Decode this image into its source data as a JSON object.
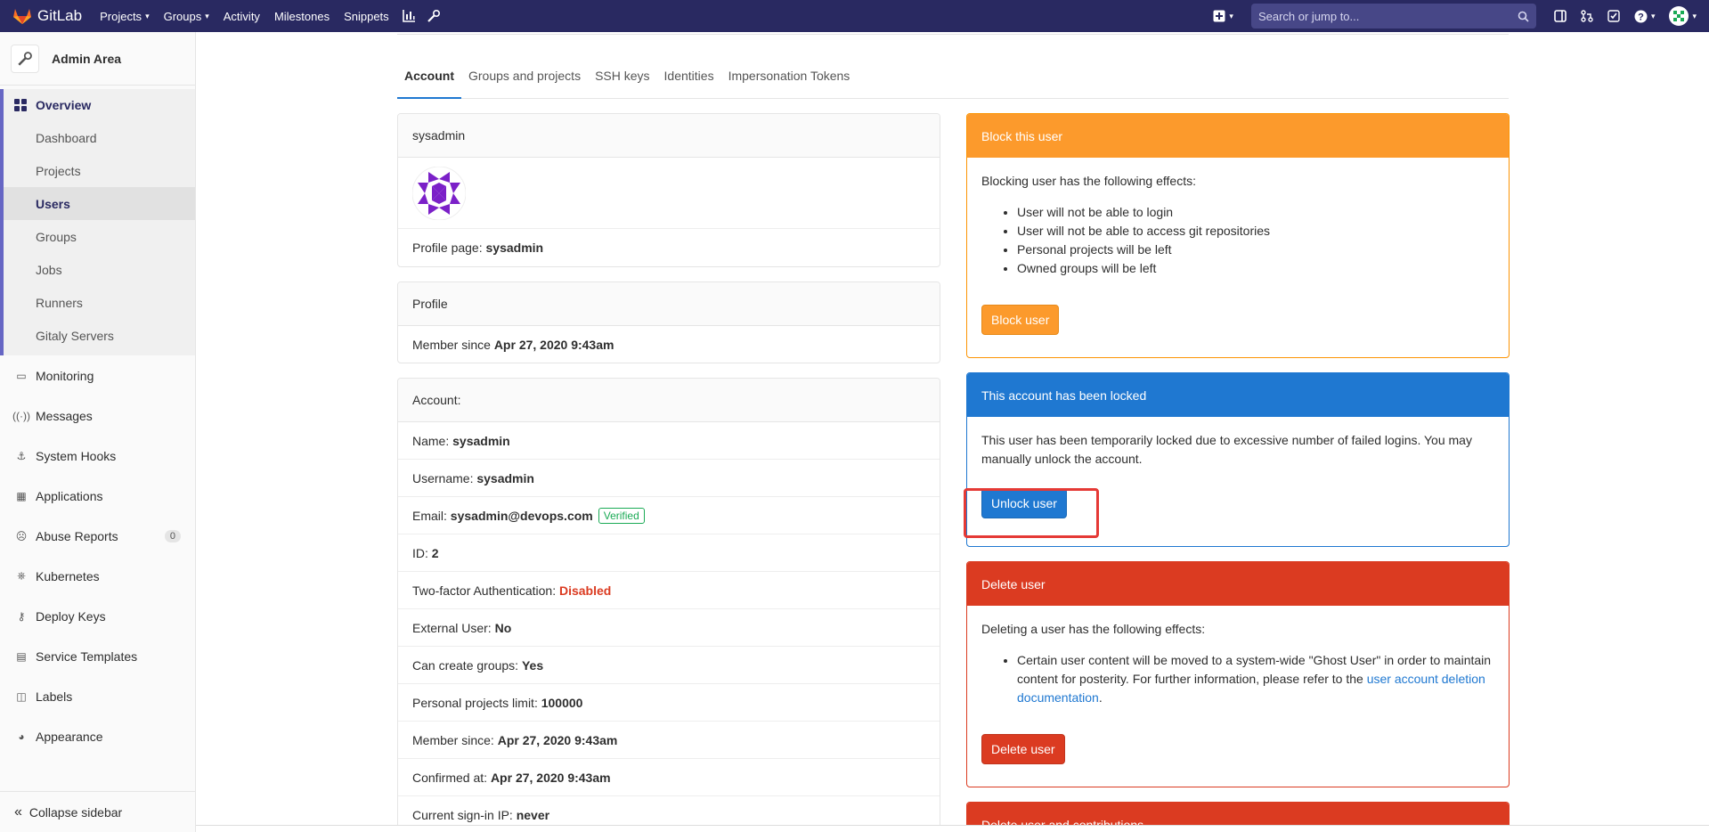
{
  "topnav": {
    "brand": "GitLab",
    "items": [
      {
        "label": "Projects",
        "caret": true
      },
      {
        "label": "Groups",
        "caret": true
      },
      {
        "label": "Activity",
        "caret": false
      },
      {
        "label": "Milestones",
        "caret": false
      },
      {
        "label": "Snippets",
        "caret": false
      }
    ],
    "search_placeholder": "Search or jump to...",
    "icons": [
      "chart-icon",
      "wrench-icon",
      "plus-square-icon",
      "search-icon",
      "sidebar-icon",
      "merge-request-icon",
      "todo-check-icon",
      "help-icon",
      "user-avatar-icon"
    ]
  },
  "sidebar": {
    "title": "Admin Area",
    "overview_label": "Overview",
    "sub_items": [
      "Dashboard",
      "Projects",
      "Users",
      "Groups",
      "Jobs",
      "Runners",
      "Gitaly Servers"
    ],
    "active_sub": "Users",
    "items": [
      {
        "label": "Monitoring",
        "icon": "monitor-icon"
      },
      {
        "label": "Messages",
        "icon": "broadcast-icon"
      },
      {
        "label": "System Hooks",
        "icon": "hook-icon"
      },
      {
        "label": "Applications",
        "icon": "grid-icon"
      },
      {
        "label": "Abuse Reports",
        "icon": "abuse-icon",
        "badge": "0"
      },
      {
        "label": "Kubernetes",
        "icon": "kubernetes-icon"
      },
      {
        "label": "Deploy Keys",
        "icon": "key-icon"
      },
      {
        "label": "Service Templates",
        "icon": "template-icon"
      },
      {
        "label": "Labels",
        "icon": "label-icon"
      },
      {
        "label": "Appearance",
        "icon": "palette-icon"
      }
    ],
    "collapse_label": "Collapse sidebar"
  },
  "tabs": [
    "Account",
    "Groups and projects",
    "SSH keys",
    "Identities",
    "Impersonation Tokens"
  ],
  "active_tab": "Account",
  "user_card": {
    "username": "sysadmin",
    "profile_page_label": "Profile page:",
    "profile_page_value": "sysadmin"
  },
  "profile_card": {
    "title": "Profile",
    "member_since_label": "Member since",
    "member_since_value": "Apr 27, 2020 9:43am"
  },
  "account_card": {
    "title": "Account:",
    "rows": [
      {
        "label": "Name:",
        "value": "sysadmin"
      },
      {
        "label": "Username:",
        "value": "sysadmin"
      },
      {
        "label": "Email:",
        "value": "sysadmin@devops.com",
        "badge": "Verified"
      },
      {
        "label": "ID:",
        "value": "2"
      },
      {
        "label": "Two-factor Authentication:",
        "value": "Disabled",
        "status": "danger"
      },
      {
        "label": "External User:",
        "value": "No"
      },
      {
        "label": "Can create groups:",
        "value": "Yes"
      },
      {
        "label": "Personal projects limit:",
        "value": "100000"
      },
      {
        "label": "Member since:",
        "value": "Apr 27, 2020 9:43am"
      },
      {
        "label": "Confirmed at:",
        "value": "Apr 27, 2020 9:43am"
      },
      {
        "label": "Current sign-in IP:",
        "value": "never"
      }
    ]
  },
  "block_card": {
    "title": "Block this user",
    "intro": "Blocking user has the following effects:",
    "effects": [
      "User will not be able to login",
      "User will not be able to access git repositories",
      "Personal projects will be left",
      "Owned groups will be left"
    ],
    "button": "Block user"
  },
  "locked_card": {
    "title": "This account has been locked",
    "text": "This user has been temporarily locked due to excessive number of failed logins. You may manually unlock the account.",
    "button": "Unlock user"
  },
  "delete_card": {
    "title": "Delete user",
    "intro": "Deleting a user has the following effects:",
    "effect_text": "Certain user content will be moved to a system-wide \"Ghost User\" in order to maintain content for posterity. For further information, please refer to the",
    "effect_link": "user account deletion documentation",
    "effect_end": ".",
    "button": "Delete user"
  },
  "delete_contrib_card": {
    "title": "Delete user and contributions"
  },
  "colors": {
    "nav_bg": "#292961",
    "block_orange": "#fc9a2c",
    "locked_blue": "#1f78d1",
    "delete_red": "#db3b21",
    "verified_green": "#1aaa55"
  }
}
